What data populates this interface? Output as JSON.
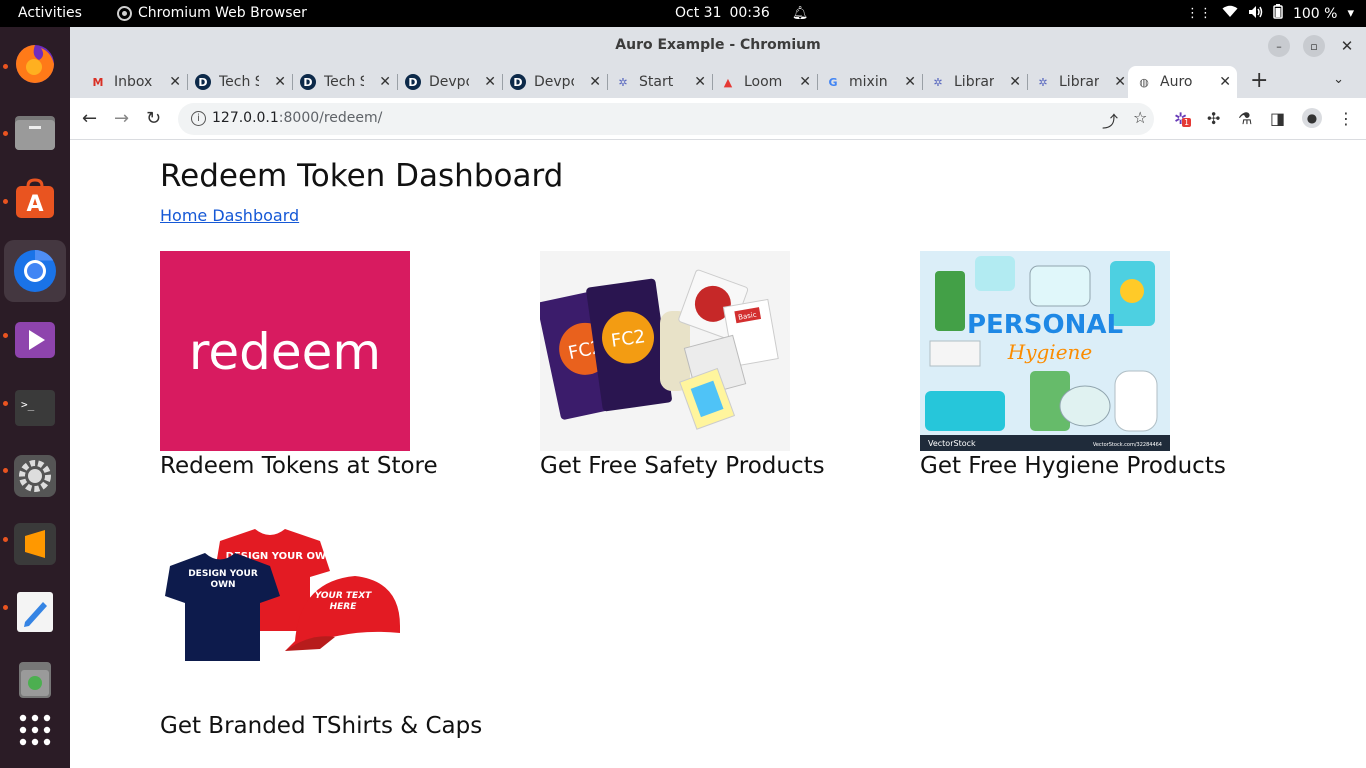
{
  "topbar": {
    "activities": "Activities",
    "app_name": "Chromium Web Browser",
    "date": "Oct 31",
    "time": "00:36",
    "battery": "100 %"
  },
  "window": {
    "title": "Auro Example - Chromium"
  },
  "tabs": [
    {
      "title": "Inbox",
      "favicon": "gmail-icon"
    },
    {
      "title": "Tech S",
      "favicon": "dev-icon"
    },
    {
      "title": "Tech S",
      "favicon": "dev-icon"
    },
    {
      "title": "Devpo",
      "favicon": "dev-icon"
    },
    {
      "title": "Devpo",
      "favicon": "dev-icon"
    },
    {
      "title": "Start",
      "favicon": "gear-blue-icon"
    },
    {
      "title": "Loom",
      "favicon": "loom-icon"
    },
    {
      "title": "mixin",
      "favicon": "google-icon"
    },
    {
      "title": "Librar",
      "favicon": "gear-blue-icon"
    },
    {
      "title": "Librar",
      "favicon": "gear-blue-icon"
    },
    {
      "title": "Auro",
      "favicon": "globe-icon"
    }
  ],
  "address_bar": {
    "host": "127.0.0.1",
    "rest": ":8000/redeem/"
  },
  "extension_badge": "1",
  "page": {
    "title": "Redeem Token Dashboard",
    "home_link": "Home Dashboard",
    "cards": [
      {
        "caption": "Redeem Tokens at Store",
        "image": "redeem-logo",
        "logo_text": "redeem",
        "color": "#d81b60"
      },
      {
        "caption": "Get Free Safety Products",
        "image": "safety-products-photo",
        "labels": [
          "FC2",
          "FC2",
          "Basic"
        ]
      },
      {
        "caption": "Get Free Hygiene Products",
        "image": "hygiene-products-illustration",
        "labels": [
          "PERSONAL",
          "Hygiene",
          "VectorStock",
          "VectorStock.com/32284464"
        ]
      },
      {
        "caption": "Get Branded TShirts & Caps",
        "image": "tshirts-caps-photo",
        "labels": [
          "DESIGN YOUR OWN",
          "DESIGN YOUR OWN",
          "YOUR TEXT HERE"
        ]
      }
    ]
  },
  "colors": {
    "dock_bg": "#2b1c26",
    "tabstrip_bg": "#dee1e6",
    "link": "#1558d6",
    "ubuntu_orange": "#e95420"
  }
}
